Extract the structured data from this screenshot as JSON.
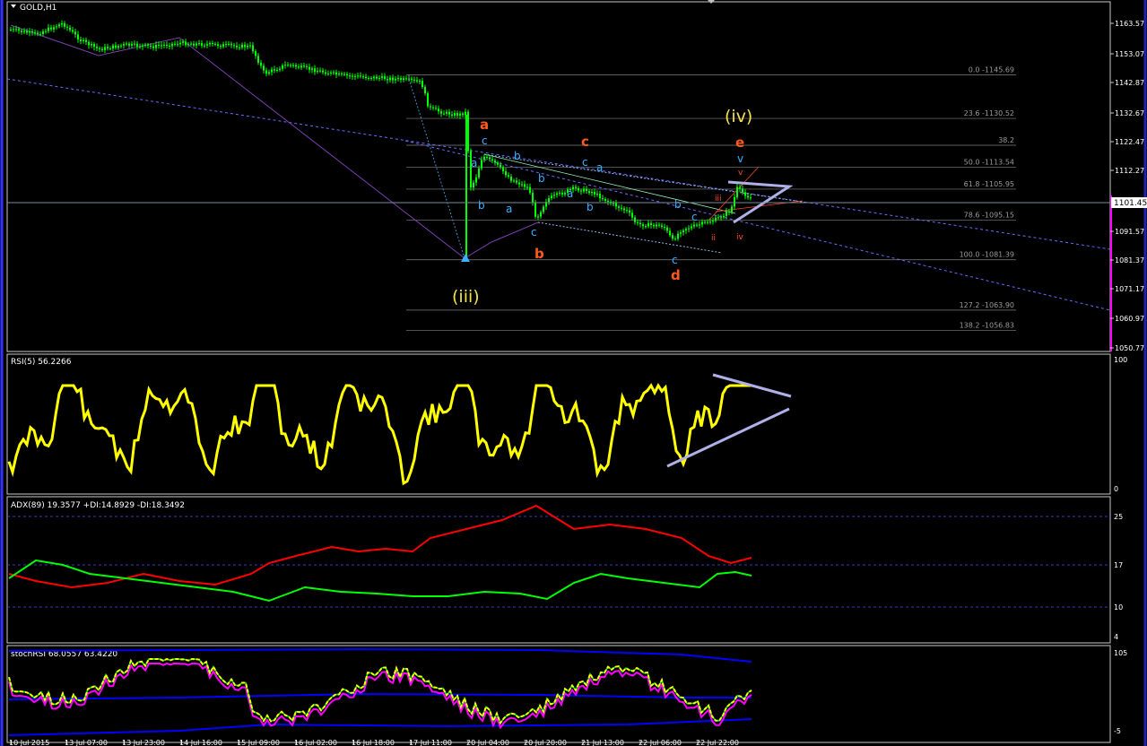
{
  "symbol": "GOLD,H1",
  "current_price": "1101.45",
  "price_axis": {
    "ticks": [
      "1163.57",
      "1153.07",
      "1142.87",
      "1132.67",
      "1122.47",
      "1112.27",
      "1101.45",
      "1091.57",
      "1081.37",
      "1071.17",
      "1060.97",
      "1050.77"
    ]
  },
  "time_axis": {
    "ticks": [
      "10 Jul 2015",
      "13 Jul 07:00",
      "13 Jul 23:00",
      "14 Jul 16:00",
      "15 Jul 09:00",
      "16 Jul 02:00",
      "16 Jul 18:00",
      "17 Jul 11:00",
      "20 Jul 04:00",
      "20 Jul 20:00",
      "21 Jul 13:00",
      "22 Jul 06:00",
      "22 Jul 22:00"
    ]
  },
  "fib_levels": [
    {
      "label": "0.0 -1145.69",
      "price": 1145.69
    },
    {
      "label": "23.6 -1130.52",
      "price": 1130.52
    },
    {
      "label": "38.2",
      "price": 1121.2
    },
    {
      "label": "50.0 -1113.54",
      "price": 1113.54
    },
    {
      "label": "61.8 -1105.95",
      "price": 1105.95
    },
    {
      "label": "78.6 -1095.15",
      "price": 1095.15
    },
    {
      "label": "100.0 -1081.39",
      "price": 1081.39
    },
    {
      "label": "127.2 -1063.90",
      "price": 1063.9
    },
    {
      "label": "138.2 -1056.83",
      "price": 1056.83
    }
  ],
  "wave_labels": {
    "iii": "(iii)",
    "iv": "(iv)",
    "a": "a",
    "b": "b",
    "c": "c",
    "d": "d",
    "e": "e",
    "minor": [
      "c",
      "a",
      "b",
      "b",
      "a",
      "c",
      "b",
      "a",
      "c",
      "b",
      "a",
      "b",
      "c",
      "c",
      "v",
      "iii",
      "ii",
      "iv"
    ]
  },
  "rsi": {
    "label": "RSI(5) 56.2266",
    "ticks": [
      "100",
      "0"
    ]
  },
  "adx": {
    "label": "ADX(89) 19.3577 +DI:14.8929 -DI:18.3492",
    "ticks": [
      "25",
      "17",
      "10",
      "4"
    ]
  },
  "stoch": {
    "label": "stochRSI 68.0557 63.4220",
    "ticks": [
      "105",
      "-5"
    ]
  },
  "colors": {
    "up": "#00ff00",
    "down": "#ff0000",
    "rsi": "#ffff00",
    "fib": "#808080",
    "trend": "#6a6aff",
    "triangle": "#b0b0e8",
    "wave_major": "#ff5a1e",
    "wave_minor": "#3ab0ff",
    "wave_big": "#f2e24a",
    "magenta": "#ff00ff",
    "blue": "#0000ff"
  },
  "chart_data": {
    "type": "line",
    "title": "GOLD,H1",
    "ylim": [
      1050.77,
      1168
    ],
    "series": [
      {
        "name": "GOLD,H1",
        "values": [
          1166,
          1165,
          1163,
          1164,
          1162,
          1160,
          1157,
          1156,
          1157,
          1154,
          1158,
          1160,
          1157,
          1152,
          1148,
          1147,
          1146,
          1146,
          1145,
          1145,
          1146,
          1146,
          1144,
          1134,
          1131,
          1132,
          1107,
          1115,
          1113,
          1110,
          1108,
          1105,
          1109,
          1111,
          1107,
          1105,
          1101,
          1097,
          1093,
          1092,
          1094,
          1096,
          1091,
          1094,
          1096,
          1098,
          1104,
          1101,
          1107,
          1106,
          1104
        ]
      }
    ]
  }
}
